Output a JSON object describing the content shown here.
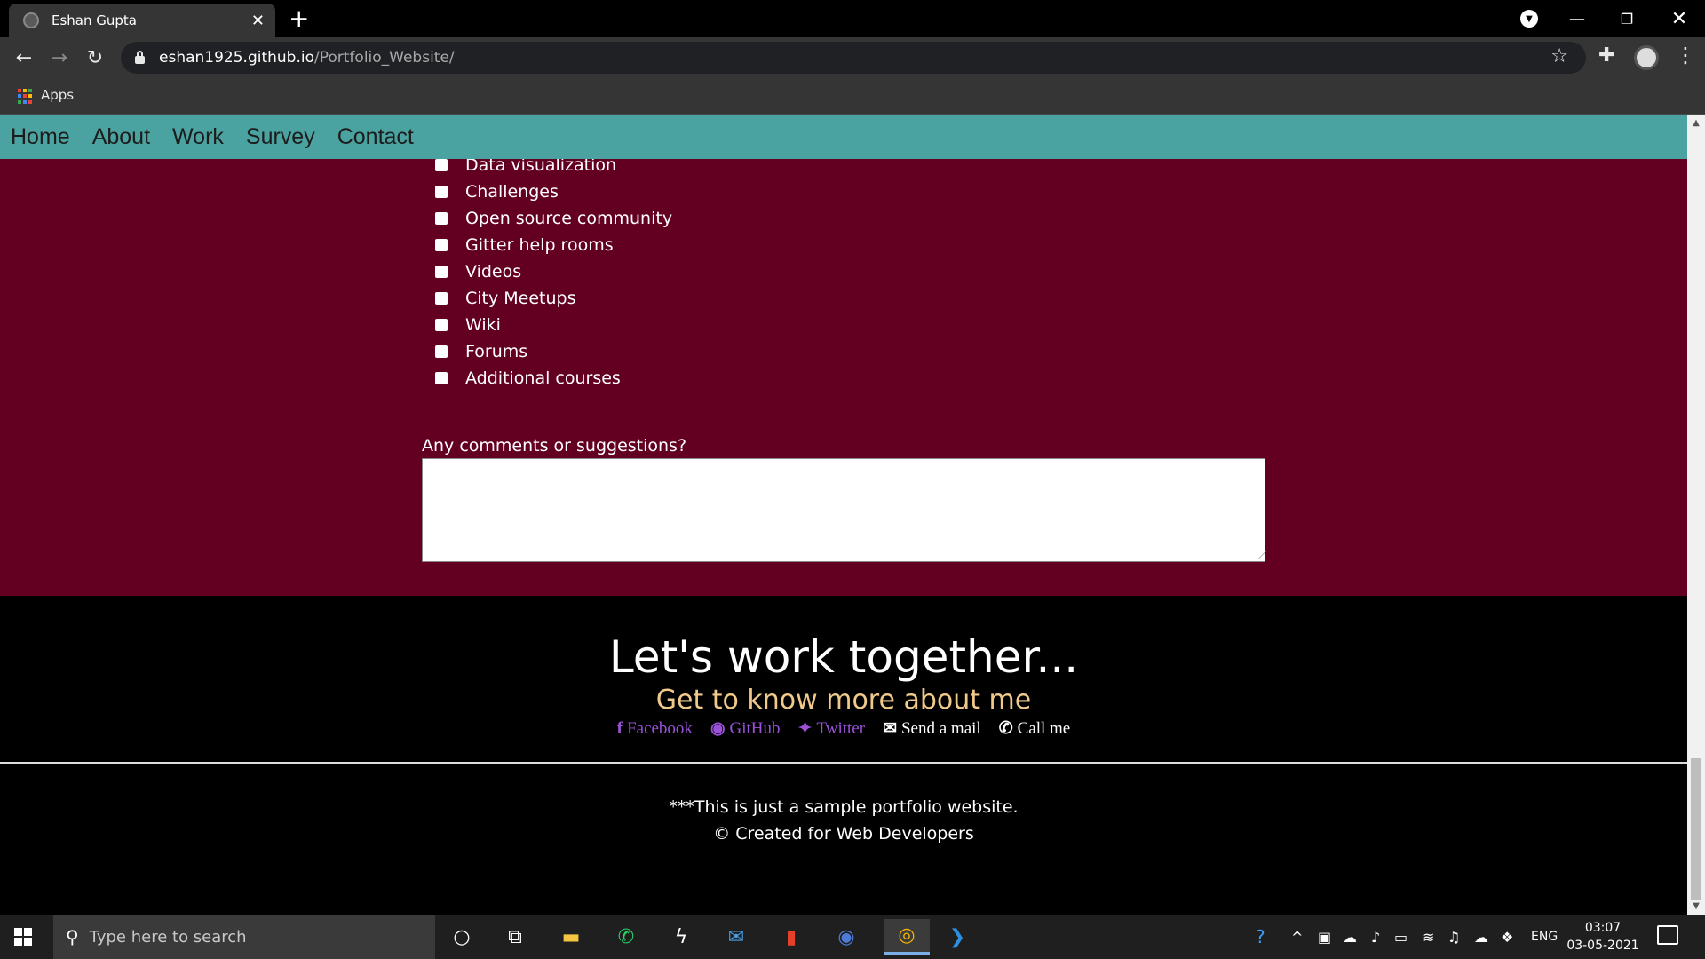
{
  "browser": {
    "tab_title": "Eshan Gupta",
    "tab_close": "✕",
    "new_tab": "+",
    "url_host": "eshan1925.github.io",
    "url_path": "/Portfolio_Website/",
    "bookmarks_apps": "Apps",
    "controls": {
      "minimize": "—",
      "maximize": "❐",
      "close": "✕",
      "back": "←",
      "forward": "→",
      "reload": "↻",
      "star": "☆",
      "extensions": "✚",
      "menu": "⋮"
    }
  },
  "site": {
    "nav": [
      "Home",
      "About",
      "Work",
      "Survey",
      "Contact"
    ],
    "checklist": [
      "Data visualization",
      "Challenges",
      "Open source community",
      "Gitter help rooms",
      "Videos",
      "City Meetups",
      "Wiki",
      "Forums",
      "Additional courses"
    ],
    "comments_label": "Any comments or suggestions?",
    "contact_heading": "Let's work together...",
    "contact_subheading": "Get to know more about me",
    "socials": [
      {
        "icon": "f",
        "label": "Facebook"
      },
      {
        "icon": "◉",
        "label": "GitHub"
      },
      {
        "icon": "✦",
        "label": "Twitter"
      },
      {
        "icon": "✉",
        "label": "Send a mail"
      },
      {
        "icon": "✆",
        "label": "Call me"
      }
    ],
    "footer_line1": "***This is just a sample portfolio website.",
    "footer_line2": "© Created for Web Developers"
  },
  "taskbar": {
    "search_placeholder": "Type here to search",
    "lang": "ENG",
    "time": "03:07",
    "date": "03-05-2021"
  }
}
